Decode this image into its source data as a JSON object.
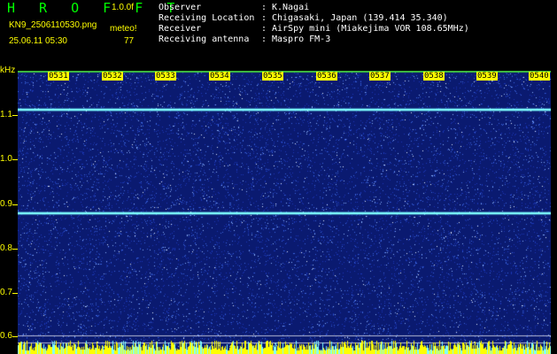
{
  "header": {
    "title": "H R O F F T",
    "version": "1.0.0f",
    "filename": "KN9_2506110530.png",
    "meteo_label": "meteo!",
    "datetime": "25.06.11 05:30",
    "count": "77"
  },
  "meta": [
    {
      "label": "Observer",
      "value": "K.Nagai"
    },
    {
      "label": "Receiving Location",
      "value": "Chigasaki, Japan (139.414 35.340)"
    },
    {
      "label": "Receiver",
      "value": "AirSpy mini (Miakejima VOR 108.65MHz)"
    },
    {
      "label": "Receiving antenna",
      "value": "Maspro FM-3"
    }
  ],
  "axis": {
    "y_unit": "kHz",
    "y_ticks": [
      "1.1",
      "1.0",
      "0.9",
      "0.8",
      "0.7",
      "0.6"
    ],
    "y_range": [
      0.58,
      1.18
    ],
    "x_ticks": [
      "0531",
      "0532",
      "0533",
      "0534",
      "0535",
      "0536",
      "0537",
      "0538",
      "0539",
      "0540"
    ]
  },
  "spectrogram": {
    "background_color": "#0a1a70",
    "speckle_color": "#8ab4ff",
    "signal_lines_khz": [
      1.1,
      0.88
    ],
    "signal_color": "#7fffff",
    "reference_lines_khz": [
      0.62,
      0.605
    ],
    "reference_color": "#ffffff",
    "bottom_band_color": "#ffff00"
  }
}
